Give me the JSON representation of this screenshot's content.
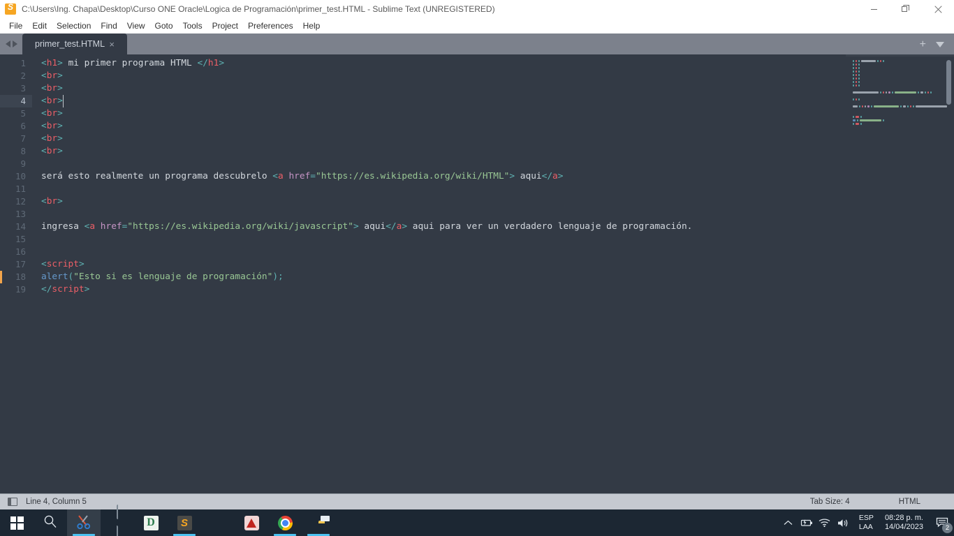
{
  "window": {
    "title": "C:\\Users\\Ing. Chapa\\Desktop\\Curso ONE Oracle\\Logica de Programación\\primer_test.HTML - Sublime Text (UNREGISTERED)",
    "app_icon": "sublime-logo-icon",
    "controls": {
      "minimize": "minimize-icon",
      "restore": "restore-icon",
      "close": "close-icon"
    }
  },
  "menubar": {
    "items": [
      {
        "label": "File"
      },
      {
        "label": "Edit"
      },
      {
        "label": "Selection"
      },
      {
        "label": "Find"
      },
      {
        "label": "View"
      },
      {
        "label": "Goto"
      },
      {
        "label": "Tools"
      },
      {
        "label": "Project"
      },
      {
        "label": "Preferences"
      },
      {
        "label": "Help"
      }
    ]
  },
  "tabbar": {
    "nav_prev": "chevron-left-icon",
    "nav_next": "chevron-right-icon",
    "tabs": [
      {
        "label": "primer_test.HTML",
        "close": "×",
        "active": true
      }
    ],
    "add_label": "+",
    "dropdown": "chevron-down-icon"
  },
  "editor": {
    "active_line": 4,
    "marked_line": 18,
    "lines": [
      {
        "n": 1,
        "tokens": [
          {
            "t": "punct",
            "v": "<"
          },
          {
            "t": "tag",
            "v": "h1"
          },
          {
            "t": "punct",
            "v": ">"
          },
          {
            "t": "text",
            "v": " mi primer programa HTML "
          },
          {
            "t": "punct",
            "v": "</"
          },
          {
            "t": "tag",
            "v": "h1"
          },
          {
            "t": "punct",
            "v": ">"
          }
        ]
      },
      {
        "n": 2,
        "tokens": [
          {
            "t": "punct",
            "v": "<"
          },
          {
            "t": "tag",
            "v": "br"
          },
          {
            "t": "punct",
            "v": ">"
          }
        ]
      },
      {
        "n": 3,
        "tokens": [
          {
            "t": "punct",
            "v": "<"
          },
          {
            "t": "tag",
            "v": "br"
          },
          {
            "t": "punct",
            "v": ">"
          }
        ]
      },
      {
        "n": 4,
        "tokens": [
          {
            "t": "punct",
            "v": "<"
          },
          {
            "t": "tag",
            "v": "br"
          },
          {
            "t": "punct",
            "v": ">"
          }
        ]
      },
      {
        "n": 5,
        "tokens": [
          {
            "t": "punct",
            "v": "<"
          },
          {
            "t": "tag",
            "v": "br"
          },
          {
            "t": "punct",
            "v": ">"
          }
        ]
      },
      {
        "n": 6,
        "tokens": [
          {
            "t": "punct",
            "v": "<"
          },
          {
            "t": "tag",
            "v": "br"
          },
          {
            "t": "punct",
            "v": ">"
          }
        ]
      },
      {
        "n": 7,
        "tokens": [
          {
            "t": "punct",
            "v": "<"
          },
          {
            "t": "tag",
            "v": "br"
          },
          {
            "t": "punct",
            "v": ">"
          }
        ]
      },
      {
        "n": 8,
        "tokens": [
          {
            "t": "punct",
            "v": "<"
          },
          {
            "t": "tag",
            "v": "br"
          },
          {
            "t": "punct",
            "v": ">"
          }
        ]
      },
      {
        "n": 9,
        "tokens": []
      },
      {
        "n": 10,
        "tokens": [
          {
            "t": "text",
            "v": "será esto realmente un programa descubrelo "
          },
          {
            "t": "punct",
            "v": "<"
          },
          {
            "t": "tag",
            "v": "a"
          },
          {
            "t": "text",
            "v": " "
          },
          {
            "t": "attr",
            "v": "href"
          },
          {
            "t": "punct",
            "v": "="
          },
          {
            "t": "string",
            "v": "\"https://es.wikipedia.org/wiki/HTML\""
          },
          {
            "t": "punct",
            "v": ">"
          },
          {
            "t": "text",
            "v": " aqui"
          },
          {
            "t": "punct",
            "v": "</"
          },
          {
            "t": "tag",
            "v": "a"
          },
          {
            "t": "punct",
            "v": ">"
          }
        ]
      },
      {
        "n": 11,
        "tokens": []
      },
      {
        "n": 12,
        "tokens": [
          {
            "t": "punct",
            "v": "<"
          },
          {
            "t": "tag",
            "v": "br"
          },
          {
            "t": "punct",
            "v": ">"
          }
        ]
      },
      {
        "n": 13,
        "tokens": []
      },
      {
        "n": 14,
        "tokens": [
          {
            "t": "text",
            "v": "ingresa "
          },
          {
            "t": "punct",
            "v": "<"
          },
          {
            "t": "tag",
            "v": "a"
          },
          {
            "t": "text",
            "v": " "
          },
          {
            "t": "attr",
            "v": "href"
          },
          {
            "t": "punct",
            "v": "="
          },
          {
            "t": "string",
            "v": "\"https://es.wikipedia.org/wiki/javascript\""
          },
          {
            "t": "punct",
            "v": ">"
          },
          {
            "t": "text",
            "v": " aqui"
          },
          {
            "t": "punct",
            "v": "</"
          },
          {
            "t": "tag",
            "v": "a"
          },
          {
            "t": "punct",
            "v": ">"
          },
          {
            "t": "text",
            "v": " aqui para ver un verdadero lenguaje de programación."
          }
        ]
      },
      {
        "n": 15,
        "tokens": []
      },
      {
        "n": 16,
        "tokens": []
      },
      {
        "n": 17,
        "tokens": [
          {
            "t": "punct",
            "v": "<"
          },
          {
            "t": "tag",
            "v": "script"
          },
          {
            "t": "punct",
            "v": ">"
          }
        ]
      },
      {
        "n": 18,
        "tokens": [
          {
            "t": "func",
            "v": "alert"
          },
          {
            "t": "punct",
            "v": "("
          },
          {
            "t": "string",
            "v": "\"Esto si es lenguaje de programación\""
          },
          {
            "t": "punct",
            "v": ");"
          }
        ]
      },
      {
        "n": 19,
        "tokens": [
          {
            "t": "punct",
            "v": "</"
          },
          {
            "t": "tag",
            "v": "script"
          },
          {
            "t": "punct",
            "v": ">"
          }
        ]
      }
    ]
  },
  "minimap": {
    "scrollbar": "minimap-scrollbar"
  },
  "statusbar": {
    "sidebar_toggle": "sidebar-toggle-icon",
    "position": "Line 4, Column 5",
    "tab_size": "Tab Size: 4",
    "syntax": "HTML"
  },
  "taskbar": {
    "items": [
      {
        "name": "start-button",
        "icon": "windows-logo-icon",
        "active": false,
        "running": false
      },
      {
        "name": "search-button",
        "icon": "search-icon",
        "active": false,
        "running": false
      },
      {
        "name": "snipping-tool",
        "icon": "snipping-tool-icon",
        "active": true,
        "running": true
      },
      {
        "name": "calculator",
        "icon": "calculator-icon",
        "active": false,
        "running": false
      },
      {
        "name": "dia-app",
        "icon": "dia-icon",
        "active": false,
        "running": false
      },
      {
        "name": "sublime-text",
        "icon": "sublime-icon",
        "active": false,
        "running": true
      },
      {
        "name": "microsoft-edge",
        "icon": "edge-icon",
        "active": false,
        "running": false
      },
      {
        "name": "autocad",
        "icon": "autocad-icon",
        "active": false,
        "running": false
      },
      {
        "name": "google-chrome",
        "icon": "chrome-icon",
        "active": false,
        "running": true
      },
      {
        "name": "file-explorer",
        "icon": "folder-icon",
        "active": false,
        "running": true
      }
    ],
    "tray": {
      "overflow": "chevron-up-icon",
      "battery": "battery-icon",
      "network": "wifi-icon",
      "volume": "speaker-icon",
      "lang_top": "ESP",
      "lang_bottom": "LAA",
      "time": "08:28 p. m.",
      "date": "14/04/2023",
      "notifications": "notification-icon",
      "notification_count": "2"
    }
  },
  "colors": {
    "editor_bg": "#333A45",
    "tabbar_bg": "#7C818C",
    "status_bg": "#c5c9d0",
    "taskbar_bg": "#1c2733",
    "accent_orange": "#F6A623",
    "tag_red": "#EC5F67",
    "punct_teal": "#5FB3B3",
    "string_green": "#99C794",
    "attr_pink": "#C594C5",
    "func_blue": "#6699CC",
    "task_underline": "#4cc2f1"
  }
}
